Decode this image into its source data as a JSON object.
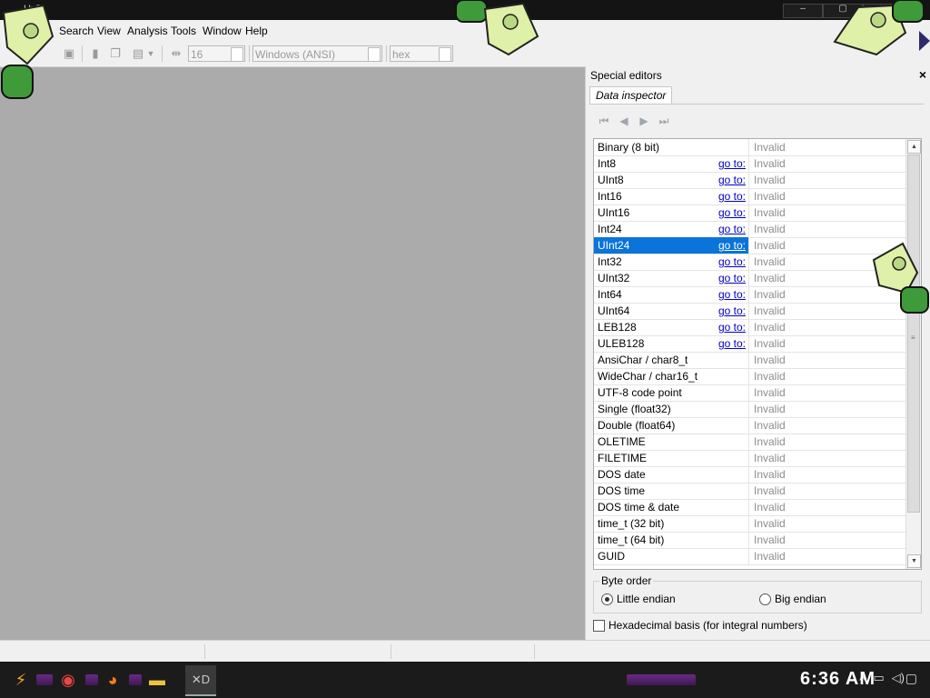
{
  "app": {
    "title": "HxD",
    "window_buttons": [
      "–",
      "▢",
      "✕"
    ]
  },
  "menu": [
    "Search",
    "View",
    "Analysis",
    "Tools",
    "Window",
    "Help"
  ],
  "toolbar": {
    "bytes_per_row": "16",
    "charset": "Windows (ANSI)",
    "offset_base": "hex"
  },
  "panel": {
    "title": "Special editors",
    "tab": "Data inspector",
    "goto_label": "go to:",
    "rows": [
      {
        "name": "Binary (8 bit)",
        "goto": false,
        "value": "Invalid"
      },
      {
        "name": "Int8",
        "goto": true,
        "value": "Invalid"
      },
      {
        "name": "UInt8",
        "goto": true,
        "value": "Invalid"
      },
      {
        "name": "Int16",
        "goto": true,
        "value": "Invalid"
      },
      {
        "name": "UInt16",
        "goto": true,
        "value": "Invalid"
      },
      {
        "name": "Int24",
        "goto": true,
        "value": "Invalid"
      },
      {
        "name": "UInt24",
        "goto": true,
        "value": "Invalid",
        "selected": true
      },
      {
        "name": "Int32",
        "goto": true,
        "value": "Invalid"
      },
      {
        "name": "UInt32",
        "goto": true,
        "value": "Invalid"
      },
      {
        "name": "Int64",
        "goto": true,
        "value": "Invalid"
      },
      {
        "name": "UInt64",
        "goto": true,
        "value": "Invalid"
      },
      {
        "name": "LEB128",
        "goto": true,
        "value": "Invalid"
      },
      {
        "name": "ULEB128",
        "goto": true,
        "value": "Invalid"
      },
      {
        "name": "AnsiChar / char8_t",
        "goto": false,
        "value": "Invalid"
      },
      {
        "name": "WideChar / char16_t",
        "goto": false,
        "value": "Invalid"
      },
      {
        "name": "UTF-8 code point",
        "goto": false,
        "value": "Invalid"
      },
      {
        "name": "Single (float32)",
        "goto": false,
        "value": "Invalid"
      },
      {
        "name": "Double (float64)",
        "goto": false,
        "value": "Invalid"
      },
      {
        "name": "OLETIME",
        "goto": false,
        "value": "Invalid"
      },
      {
        "name": "FILETIME",
        "goto": false,
        "value": "Invalid"
      },
      {
        "name": "DOS date",
        "goto": false,
        "value": "Invalid"
      },
      {
        "name": "DOS time",
        "goto": false,
        "value": "Invalid"
      },
      {
        "name": "DOS time & date",
        "goto": false,
        "value": "Invalid"
      },
      {
        "name": "time_t (32 bit)",
        "goto": false,
        "value": "Invalid"
      },
      {
        "name": "time_t (64 bit)",
        "goto": false,
        "value": "Invalid"
      },
      {
        "name": "GUID",
        "goto": false,
        "value": "Invalid"
      }
    ],
    "byte_order": {
      "label": "Byte order",
      "little": "Little endian",
      "big": "Big endian",
      "selected": "little"
    },
    "hex_basis": {
      "label": "Hexadecimal basis (for integral numbers)",
      "checked": false
    }
  },
  "taskbar": {
    "clock": "6:36 AM"
  },
  "colors": {
    "selection": "#0a74da",
    "link": "#0000c0",
    "workspace": "#ababab"
  }
}
